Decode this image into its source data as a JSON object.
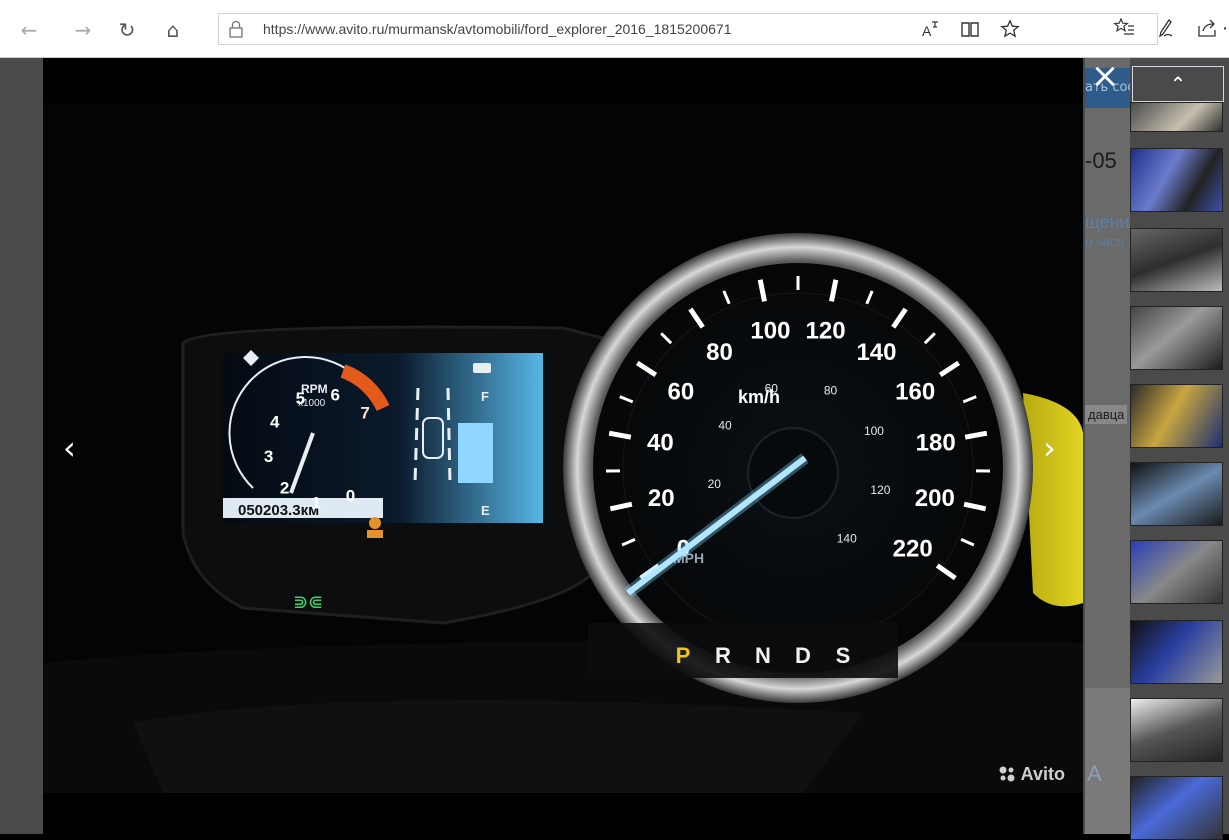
{
  "browser": {
    "url": "https://www.avito.ru/murmansk/avtomobili/ford_explorer_2016_1815200671"
  },
  "side_page": {
    "date_fragment": "-05",
    "message_fragment": "щение",
    "hours_fragment": "о часо",
    "seller_fragment": "давца",
    "send_button_fragment": "ать сообщение",
    "letter_fragment": "А"
  },
  "viewer": {
    "watermark": "Avito",
    "prev_label": "‹",
    "next_label": "›",
    "close_label": "×",
    "scroll_up_label": "⌃"
  },
  "photo": {
    "speed_labels": [
      "0",
      "20",
      "40",
      "60",
      "80",
      "100",
      "120",
      "140",
      "160",
      "180",
      "200",
      "220"
    ],
    "speed_unit": "km/h",
    "mph_labels": [
      "20",
      "40",
      "60",
      "80",
      "100",
      "120",
      "140"
    ],
    "mph_unit": "MPH",
    "rpm_labels": [
      "0",
      "1",
      "2",
      "3",
      "4",
      "5",
      "6",
      "7"
    ],
    "rpm_unit_line1": "RPM",
    "rpm_unit_line2": "x1000",
    "odometer": "050203.3км",
    "gears": [
      "P",
      "R",
      "N",
      "D",
      "S"
    ],
    "fuel_full": "F",
    "fuel_empty": "E"
  },
  "colors": {
    "viewer_bg": "#000000",
    "accent_blue": "#2f5b8a",
    "gauge_cyan": "#7fd8ff",
    "gear_active": "#f3c316",
    "rpm_redline": "#e45a1a",
    "side_yellow": "#dccd1a"
  },
  "icons": {
    "back": "←",
    "forward": "→",
    "refresh": "↻",
    "home": "⌂",
    "lock": "🔒",
    "read_aloud": "A",
    "reading_view": "📖",
    "favorite": "☆",
    "favorites_hub": "✩",
    "pen": "✎",
    "share": "⇪",
    "more": "⋯"
  }
}
